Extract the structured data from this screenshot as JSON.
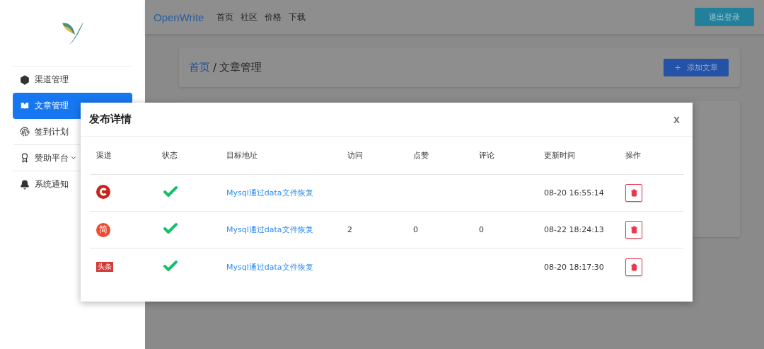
{
  "sidebar": {
    "items": [
      {
        "label": "渠道管理",
        "selected": false,
        "has_caret": false
      },
      {
        "label": "文章管理",
        "selected": true,
        "has_caret": false
      },
      {
        "label": "签到计划",
        "selected": false,
        "has_caret": false
      },
      {
        "label": "赞助平台",
        "selected": false,
        "has_caret": true
      },
      {
        "label": "系统通知",
        "selected": false,
        "has_caret": false
      }
    ]
  },
  "topbar": {
    "brand": "OpenWrite",
    "nav": [
      "首页",
      "社区",
      "价格",
      "下载"
    ],
    "logout": "退出登录"
  },
  "breadcrumb": {
    "home": "首页",
    "separator": "/",
    "current": "文章管理"
  },
  "add_button": {
    "icon": "+",
    "label": "添加文章"
  },
  "dialog": {
    "title": "发布详情",
    "close": "x",
    "table": {
      "columns": [
        "渠道",
        "状态",
        "目标地址",
        "访问",
        "点赞",
        "评论",
        "更新时间",
        "操作"
      ],
      "rows": [
        {
          "channel": {
            "kind": "c-logo"
          },
          "success": true,
          "link": "Mysql通过data文件恢复",
          "visits": "",
          "likes": "",
          "comments": "",
          "updated": "08-20 16:55:14"
        },
        {
          "channel": {
            "kind": "circle-logo",
            "text": "简"
          },
          "success": true,
          "link": "Mysql通过data文件恢复",
          "visits": "2",
          "likes": "0",
          "comments": "0",
          "updated": "08-22 18:24:13"
        },
        {
          "channel": {
            "kind": "tag-logo",
            "text": "头条"
          },
          "success": true,
          "link": "Mysql通过data文件恢复",
          "visits": "",
          "likes": "",
          "comments": "",
          "updated": "08-20 18:17:30"
        }
      ]
    }
  }
}
